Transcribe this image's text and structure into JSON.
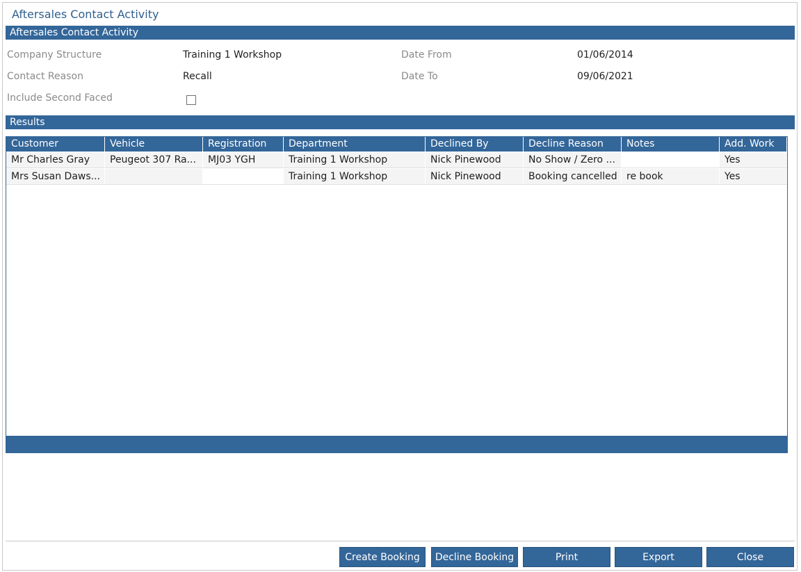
{
  "window": {
    "title": "Aftersales Contact Activity"
  },
  "criteria": {
    "section_title": "Aftersales Contact Activity",
    "company_structure_label": "Company Structure",
    "company_structure_value": "Training 1 Workshop",
    "contact_reason_label": "Contact Reason",
    "contact_reason_value": "Recall",
    "include_second_faced_label": "Include Second Faced",
    "include_second_faced_checked": false,
    "date_from_label": "Date From",
    "date_from_value": "01/06/2014",
    "date_to_label": "Date To",
    "date_to_value": "09/06/2021"
  },
  "results": {
    "section_title": "Results",
    "columns": [
      "Customer",
      "Vehicle",
      "Registration",
      "Department",
      "Declined By",
      "Decline Reason",
      "Notes",
      "Add. Work"
    ],
    "rows": [
      [
        "Mr Charles Gray",
        "Peugeot 307 Ra...",
        "MJ03 YGH",
        "Training 1 Workshop",
        "Nick Pinewood",
        "No Show / Zero ...",
        "",
        "Yes"
      ],
      [
        "Mrs Susan Daws...",
        "",
        "",
        "Training 1 Workshop",
        "Nick Pinewood",
        "Booking cancelled",
        "re book",
        "Yes"
      ]
    ]
  },
  "buttons": {
    "create_booking": "Create Booking",
    "decline_booking": "Decline Booking",
    "print": "Print",
    "export": "Export",
    "close": "Close"
  },
  "colors": {
    "accent": "#336699",
    "label_gray": "#8a8a8a",
    "title_blue": "#2f5f8f"
  }
}
